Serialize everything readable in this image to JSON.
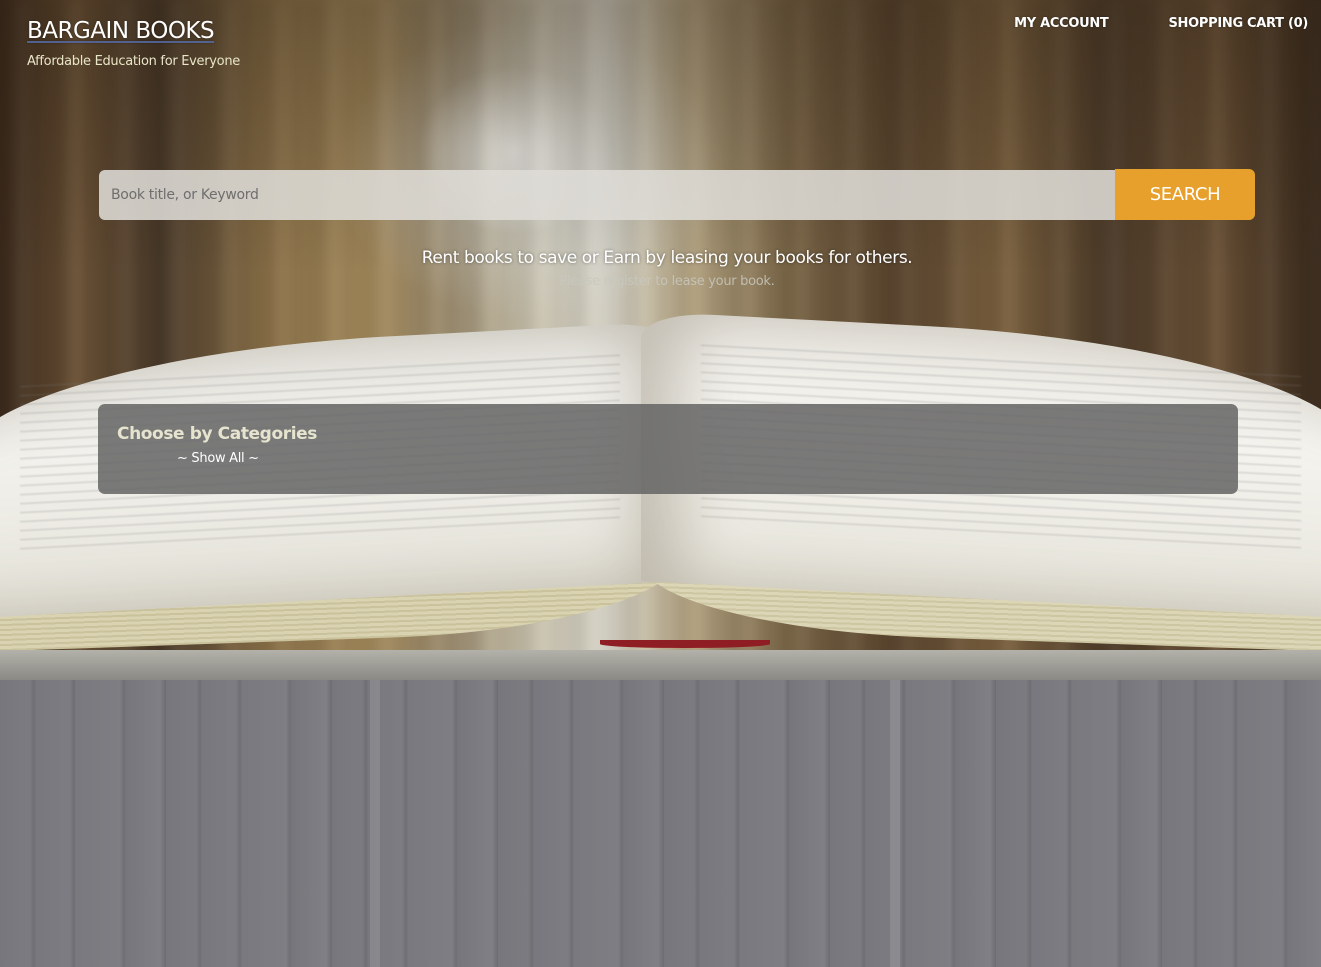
{
  "brand": {
    "title": "BARGAIN BOOKS",
    "tagline": "Affordable Education for Everyone"
  },
  "nav": {
    "my_account": "MY ACCOUNT",
    "shopping_cart": "SHOPPING CART (0)"
  },
  "search": {
    "placeholder": "Book title, or Keyword",
    "value": "",
    "button_label": "SEARCH"
  },
  "promo": {
    "headline": "Rent books to save or Earn by leasing your books for others.",
    "subtext": "Please register to lease your book."
  },
  "categories": {
    "title": "Choose by Categories",
    "show_all": "~ Show All ~"
  },
  "colors": {
    "accent": "#e8a02c",
    "panel": "#646464",
    "tagline": "#e9e6c8"
  }
}
